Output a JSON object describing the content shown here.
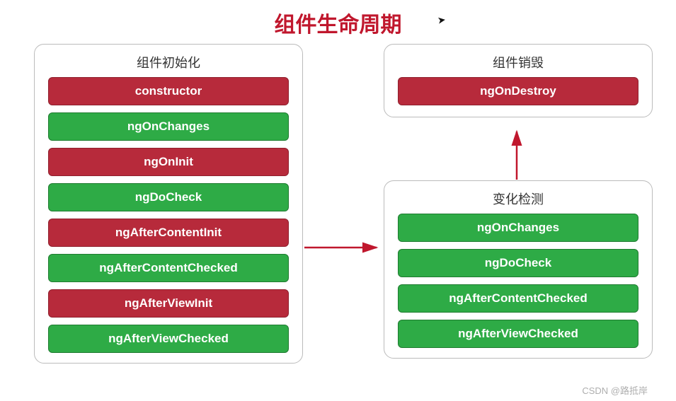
{
  "title": "组件生命周期",
  "boxes": {
    "init": {
      "label": "组件初始化",
      "items": [
        {
          "text": "constructor",
          "color": "red"
        },
        {
          "text": "ngOnChanges",
          "color": "green"
        },
        {
          "text": "ngOnInit",
          "color": "red"
        },
        {
          "text": "ngDoCheck",
          "color": "green"
        },
        {
          "text": "ngAfterContentInit",
          "color": "red"
        },
        {
          "text": "ngAfterContentChecked",
          "color": "green"
        },
        {
          "text": "ngAfterViewInit",
          "color": "red"
        },
        {
          "text": "ngAfterViewChecked",
          "color": "green"
        }
      ]
    },
    "destroy": {
      "label": "组件销毁",
      "items": [
        {
          "text": "ngOnDestroy",
          "color": "red"
        }
      ]
    },
    "change": {
      "label": "变化检测",
      "items": [
        {
          "text": "ngOnChanges",
          "color": "green"
        },
        {
          "text": "ngDoCheck",
          "color": "green"
        },
        {
          "text": "ngAfterContentChecked",
          "color": "green"
        },
        {
          "text": "ngAfterViewChecked",
          "color": "green"
        }
      ]
    }
  },
  "arrows": {
    "init_to_change": true,
    "change_to_destroy": true
  },
  "watermark": "CSDN @路抵岸",
  "colors": {
    "red": "#b72a3b",
    "green": "#2eab46",
    "title": "#c0172d"
  }
}
